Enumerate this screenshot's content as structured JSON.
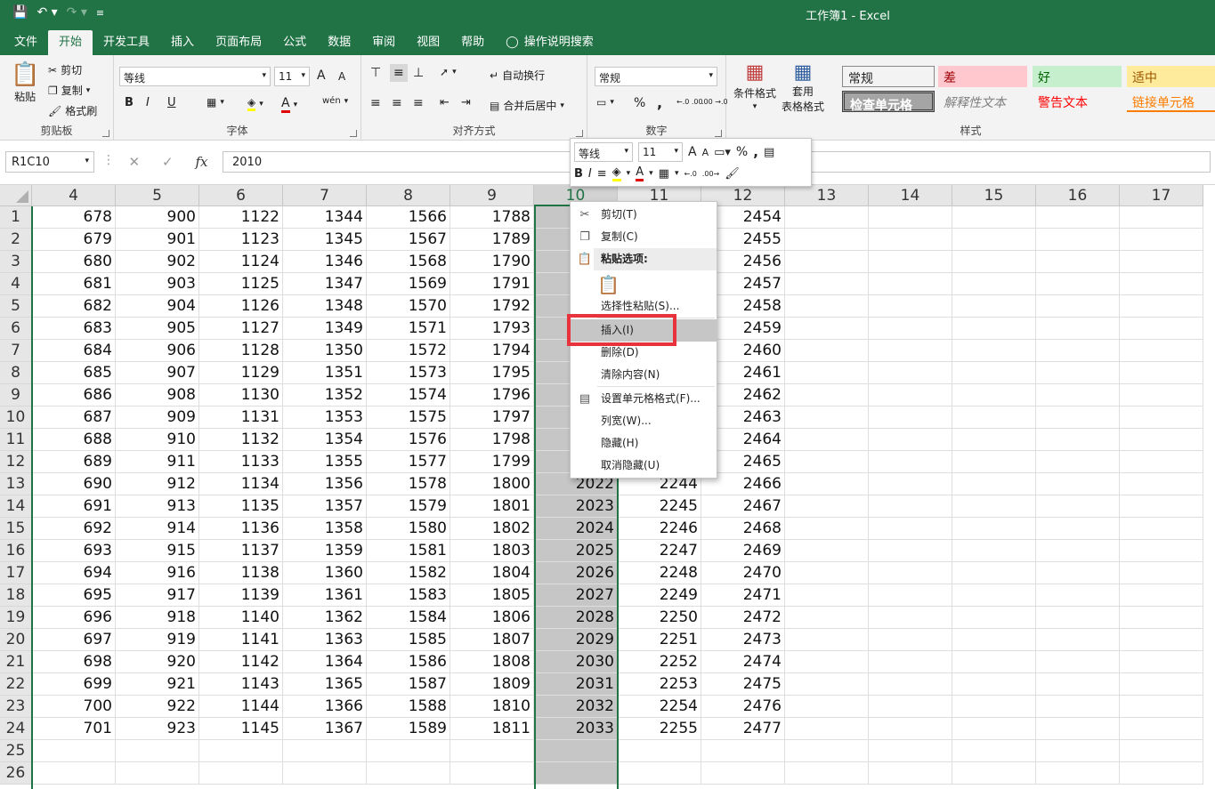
{
  "titlebar": {
    "title": "工作簿1  -  Excel",
    "undo_icon": "undo-icon",
    "redo_icon": "redo-icon"
  },
  "tabs": [
    "文件",
    "开始",
    "开发工具",
    "插入",
    "页面布局",
    "公式",
    "数据",
    "审阅",
    "视图",
    "帮助"
  ],
  "search_label": "操作说明搜索",
  "ribbon": {
    "clipboard": {
      "label": "剪贴板",
      "paste": "粘贴",
      "cut": "剪切",
      "copy": "复制",
      "painter": "格式刷"
    },
    "font": {
      "label": "字体",
      "name": "等线",
      "size": "11",
      "grow": "A",
      "shrink": "A",
      "bold": "B",
      "italic": "I",
      "underline": "U",
      "font_color": "A",
      "wen": "wén"
    },
    "align": {
      "label": "对齐方式",
      "wrap": "自动换行",
      "merge": "合并后居中"
    },
    "number": {
      "label": "数字",
      "format": "常规",
      "percent": "%",
      "comma": ",",
      "inc": "←.0 .00",
      "dec": ".00 →.0"
    },
    "styles_group": {
      "label": "样式",
      "cond": "条件格式",
      "table1": "套用",
      "table2": "表格格式"
    },
    "styles": [
      {
        "text": "常规",
        "bg": "#ffffff",
        "color": "#111111"
      },
      {
        "text": "差",
        "bg": "#ffc7ce",
        "color": "#9c0006"
      },
      {
        "text": "好",
        "bg": "#c6efce",
        "color": "#006100"
      },
      {
        "text": "适中",
        "bg": "#ffeb9c",
        "color": "#9c5700"
      },
      {
        "text": "检查单元格",
        "bg": "#a5a5a5",
        "color": "#ffffff"
      },
      {
        "text": "解释性文本",
        "bg": "#f3f3f3",
        "color": "#7f7f7f"
      },
      {
        "text": "警告文本",
        "bg": "#f3f3f3",
        "color": "#ff0000"
      },
      {
        "text": "链接单元格",
        "bg": "#f3f3f3",
        "color": "#fa7d00"
      }
    ]
  },
  "formula_bar": {
    "name_box": "R1C10",
    "fx": "fx",
    "cancel": "✕",
    "enter": "✓",
    "value": "2010"
  },
  "mini_toolbar": {
    "font": "等线",
    "size": "11",
    "grow": "A",
    "shrink": "A",
    "percent": "%",
    "comma": ",",
    "bold": "B",
    "italic": "I",
    "font_color": "A"
  },
  "context_menu": {
    "cut": "剪切(T)",
    "copy": "复制(C)",
    "paste_options": "粘贴选项:",
    "paste_special": "选择性粘贴(S)...",
    "insert": "插入(I)",
    "delete": "删除(D)",
    "clear": "清除内容(N)",
    "format_cells": "设置单元格格式(F)...",
    "col_width": "列宽(W)...",
    "hide": "隐藏(H)",
    "unhide": "取消隐藏(U)"
  },
  "grid": {
    "columns": [
      "4",
      "5",
      "6",
      "7",
      "8",
      "9",
      "10",
      "11",
      "12",
      "13",
      "14",
      "15",
      "16",
      "17"
    ],
    "selected_column": "10",
    "rows": [
      "1",
      "2",
      "3",
      "4",
      "5",
      "6",
      "7",
      "8",
      "9",
      "10",
      "11",
      "12",
      "13",
      "14",
      "15",
      "16",
      "17",
      "18",
      "19",
      "20",
      "21",
      "22",
      "23",
      "24",
      "25",
      "26"
    ],
    "visible_cells": [
      [
        "678",
        "900",
        "1122",
        "1344",
        "1566",
        "1788",
        "",
        "",
        "2454"
      ],
      [
        "679",
        "901",
        "1123",
        "1345",
        "1567",
        "1789",
        "",
        "",
        "2455"
      ],
      [
        "680",
        "902",
        "1124",
        "1346",
        "1568",
        "1790",
        "",
        "",
        "2456"
      ],
      [
        "681",
        "903",
        "1125",
        "1347",
        "1569",
        "1791",
        "",
        "",
        "2457"
      ],
      [
        "682",
        "904",
        "1126",
        "1348",
        "1570",
        "1792",
        "",
        "",
        "2458"
      ],
      [
        "683",
        "905",
        "1127",
        "1349",
        "1571",
        "1793",
        "",
        "",
        "2459"
      ],
      [
        "684",
        "906",
        "1128",
        "1350",
        "1572",
        "1794",
        "",
        "",
        "2460"
      ],
      [
        "685",
        "907",
        "1129",
        "1351",
        "1573",
        "1795",
        "",
        "",
        "2461"
      ],
      [
        "686",
        "908",
        "1130",
        "1352",
        "1574",
        "1796",
        "",
        "",
        "2462"
      ],
      [
        "687",
        "909",
        "1131",
        "1353",
        "1575",
        "1797",
        "",
        "",
        "2463"
      ],
      [
        "688",
        "910",
        "1132",
        "1354",
        "1576",
        "1798",
        "",
        "",
        "2464"
      ],
      [
        "689",
        "911",
        "1133",
        "1355",
        "1577",
        "1799",
        "",
        "",
        "2465"
      ],
      [
        "690",
        "912",
        "1134",
        "1356",
        "1578",
        "1800",
        "2022",
        "2244",
        "2466"
      ],
      [
        "691",
        "913",
        "1135",
        "1357",
        "1579",
        "1801",
        "2023",
        "2245",
        "2467"
      ],
      [
        "692",
        "914",
        "1136",
        "1358",
        "1580",
        "1802",
        "2024",
        "2246",
        "2468"
      ],
      [
        "693",
        "915",
        "1137",
        "1359",
        "1581",
        "1803",
        "2025",
        "2247",
        "2469"
      ],
      [
        "694",
        "916",
        "1138",
        "1360",
        "1582",
        "1804",
        "2026",
        "2248",
        "2470"
      ],
      [
        "695",
        "917",
        "1139",
        "1361",
        "1583",
        "1805",
        "2027",
        "2249",
        "2471"
      ],
      [
        "696",
        "918",
        "1140",
        "1362",
        "1584",
        "1806",
        "2028",
        "2250",
        "2472"
      ],
      [
        "697",
        "919",
        "1141",
        "1363",
        "1585",
        "1807",
        "2029",
        "2251",
        "2473"
      ],
      [
        "698",
        "920",
        "1142",
        "1364",
        "1586",
        "1808",
        "2030",
        "2252",
        "2474"
      ],
      [
        "699",
        "921",
        "1143",
        "1365",
        "1587",
        "1809",
        "2031",
        "2253",
        "2475"
      ],
      [
        "700",
        "922",
        "1144",
        "1366",
        "1588",
        "1810",
        "2032",
        "2254",
        "2476"
      ],
      [
        "701",
        "923",
        "1145",
        "1367",
        "1589",
        "1811",
        "2033",
        "2255",
        "2477"
      ],
      [
        "",
        "",
        "",
        "",
        "",
        "",
        "",
        "",
        ""
      ],
      [
        "",
        "",
        "",
        "",
        "",
        "",
        "",
        "",
        ""
      ]
    ]
  }
}
